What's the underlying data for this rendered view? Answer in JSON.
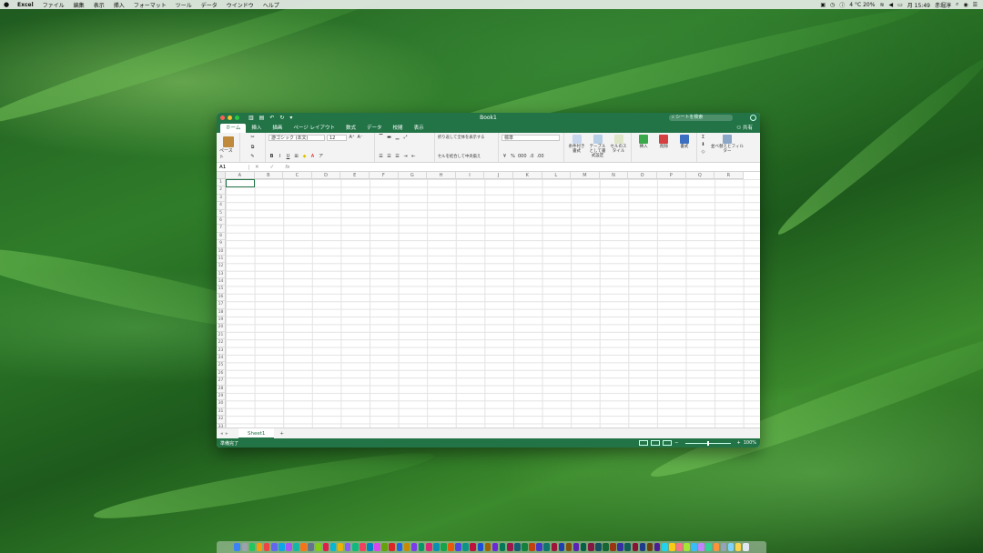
{
  "menubar": {
    "app_name": "Excel",
    "items": [
      "ファイル",
      "編集",
      "表示",
      "挿入",
      "フォーマット",
      "ツール",
      "データ",
      "ウインドウ",
      "ヘルプ"
    ],
    "weather": "4 °C 20%",
    "datetime": "月 15:49",
    "user": "赤堀淳"
  },
  "window": {
    "title": "Book1",
    "search_placeholder": "シートを検索",
    "tabs": [
      "ホーム",
      "挿入",
      "描画",
      "ページ レイアウト",
      "数式",
      "データ",
      "校閲",
      "表示"
    ],
    "active_tab": "ホーム",
    "share_label": "共有"
  },
  "ribbon": {
    "paste_label": "ペースト",
    "font_name": "游ゴシック (本文)",
    "font_size": "12",
    "bold": "B",
    "italic": "I",
    "underline": "U",
    "wrap_text": "折り返して全体を表示する",
    "merge_center": "セルを結合して中央揃え",
    "number_format": "標準",
    "percent": "%",
    "comma": "000",
    "conditional_format": "条件付き書式",
    "format_as_table": "テーブルとして書式設定",
    "cell_styles": "セルのスタイル",
    "insert": "挿入",
    "delete": "削除",
    "format": "書式",
    "sort_filter": "並べ替えとフィルター"
  },
  "formula_bar": {
    "cell_ref": "A1",
    "fx": "fx"
  },
  "grid": {
    "columns": [
      "A",
      "B",
      "C",
      "D",
      "E",
      "F",
      "G",
      "H",
      "I",
      "J",
      "K",
      "L",
      "M",
      "N",
      "O",
      "P",
      "Q",
      "R"
    ],
    "rows": [
      "1",
      "2",
      "3",
      "4",
      "5",
      "6",
      "7",
      "8",
      "9",
      "10",
      "11",
      "12",
      "13",
      "14",
      "15",
      "16",
      "17",
      "18",
      "19",
      "20",
      "21",
      "22",
      "23",
      "24",
      "25",
      "26",
      "27",
      "28",
      "29",
      "30",
      "31",
      "32",
      "33"
    ]
  },
  "sheets": {
    "tabs": [
      "Sheet1"
    ],
    "add": "+"
  },
  "status": {
    "ready": "準備完了",
    "zoom": "100%"
  }
}
